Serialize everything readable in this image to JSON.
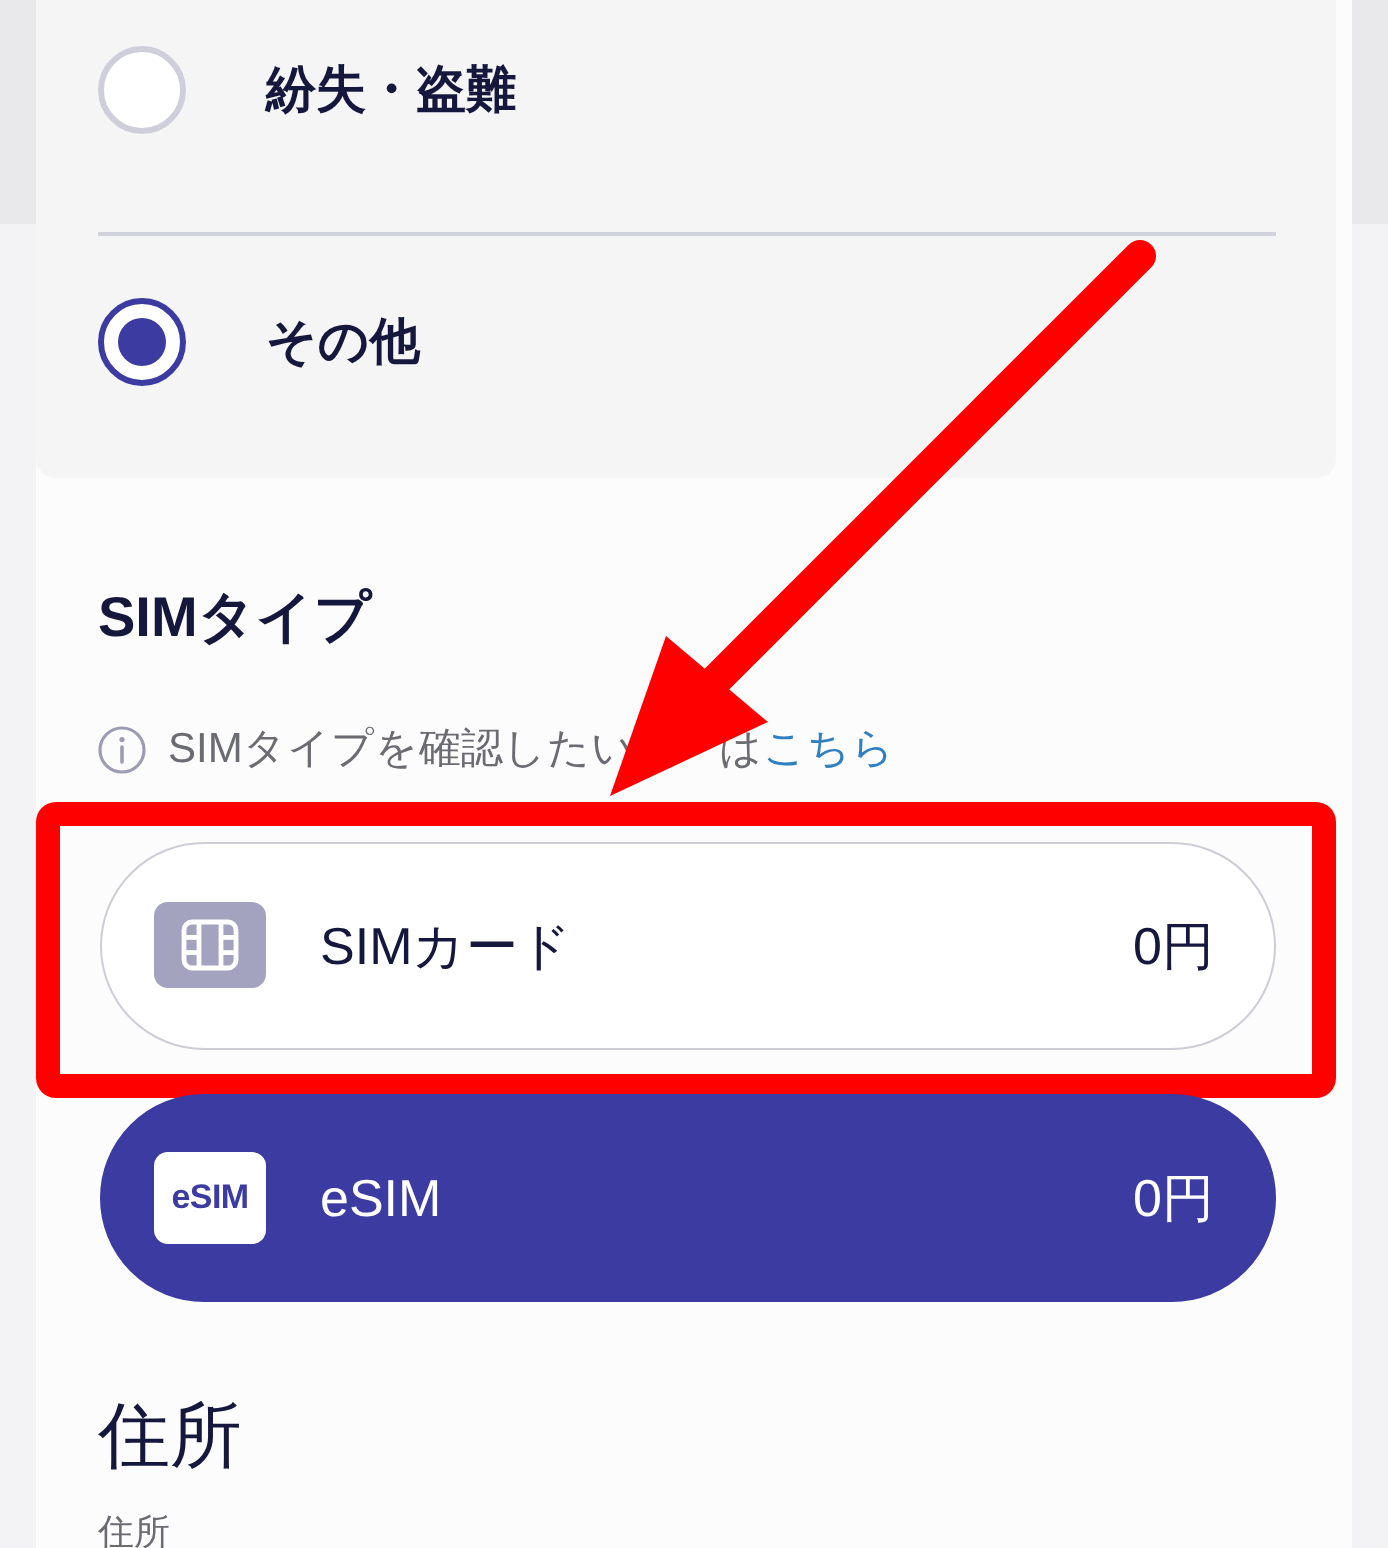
{
  "reason_options": [
    {
      "label": "紛失・盗難",
      "selected": false
    },
    {
      "label": "その他",
      "selected": true
    }
  ],
  "sim_type": {
    "heading": "SIMタイプ",
    "hint": {
      "text_before": "SIMタイプを確認したい",
      "text_after": "は",
      "link": "こちら"
    },
    "options": [
      {
        "kind": "sim-card",
        "label": "SIMカード",
        "price": "0円",
        "selected": false,
        "highlighted": true
      },
      {
        "kind": "esim",
        "icon_text": "eSIM",
        "label": "eSIM",
        "price": "0円",
        "selected": true,
        "highlighted": false
      }
    ]
  },
  "address": {
    "heading": "住所",
    "field_label": "住所"
  },
  "annotations": [
    {
      "kind": "arrow"
    }
  ]
}
